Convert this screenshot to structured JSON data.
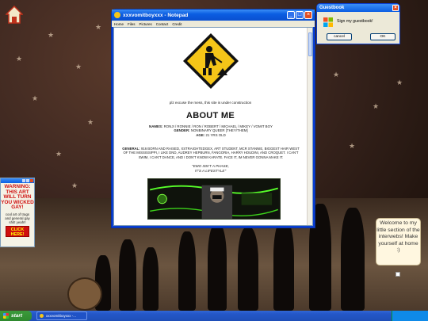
{
  "notepad": {
    "title": "xxxvomitboyxxx - Notepad",
    "menus": [
      "Home",
      "Files",
      "Pictures",
      "Contact",
      "Credit"
    ],
    "under_construction_note": "plz excuse the mess, this site is under construction",
    "about_heading": "ABOUT ME",
    "names_label": "NAMES:",
    "names_value": "RONJI / RONNIE / RON / ROBERT / MICHAEL / MIKEY / VOMIT BOY",
    "gender_label": "GENDER:",
    "gender_value": "NONBINARY QUEER [THEY/THEM]",
    "age_label": "AGE:",
    "age_value": "21 YRS OLD",
    "general_label": "GENERAL:",
    "general_value": "916 BORN AND RAISED, XSTRAIGHTEDGEX, ART STUDENT, MCR STANNIE, BIGGEST HAIR WEST OF THE MISSISSIPPI, I LIKE DND, AUDREY HEPBURN, FANGORIA, HARRY HOUDINI, AND CROQUET. I CAN'T SWIM, I CAN'T DANCE, AND I DON'T KNOW KARATE. FACE IT, IM NEVER GONNA MAKE IT.",
    "quote_line1": "\"EMO ISN'T A PHASE,",
    "quote_line2": "IT'S A LIFESTYLE\""
  },
  "guestbook": {
    "title": "Guestbook",
    "message": "Sign my guestbook!",
    "cancel_label": "cancel",
    "ok_label": "OK"
  },
  "warning_popup": {
    "heading": "WARNING: THIS ART WILL TURN YOU WICKED GAY!",
    "body": "cool art of trags and general gay shit! yeah!!",
    "button_label": "CLICK HERE!"
  },
  "desktop_note": {
    "text": "Welcome to my little section of the interwebs! Make yourself at home :)"
  },
  "taskbar": {
    "start_label": "start",
    "task_label": "xxxvomitboyxxx -..."
  },
  "colors": {
    "xp_blue": "#0a3fd4",
    "start_green": "#2f8a2f",
    "warning_red": "#d01010",
    "sign_yellow": "#f5c518"
  }
}
